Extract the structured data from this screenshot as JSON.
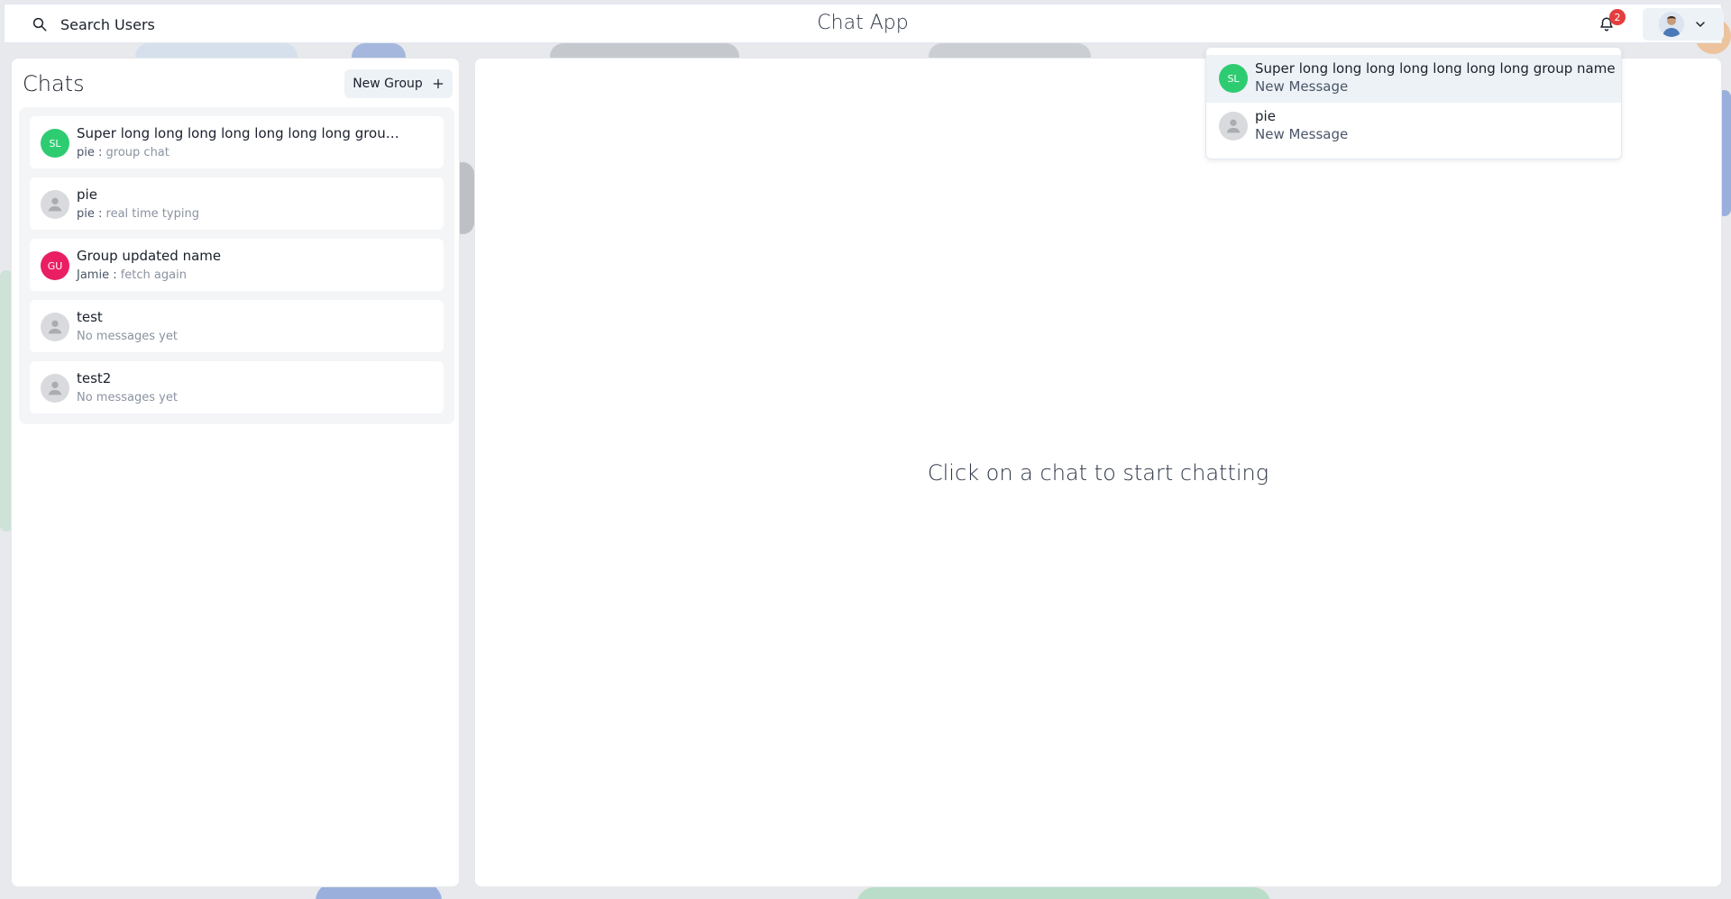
{
  "header": {
    "search_label": "Search Users",
    "app_title": "Chat App",
    "notification_count": "2"
  },
  "sidebar": {
    "title": "Chats",
    "new_group_label": "New Group",
    "chats": [
      {
        "name": "Super long long long long long long long group...",
        "initials": "SL",
        "avatar_color": "#2ecc71",
        "sender": "pie",
        "message": "group chat"
      },
      {
        "name": "pie",
        "initials": "",
        "avatar_color": "#d8dadd",
        "sender": "pie",
        "message": "real time typing"
      },
      {
        "name": "Group updated name",
        "initials": "GU",
        "avatar_color": "#e91e63",
        "sender": "Jamie",
        "message": "fetch again"
      },
      {
        "name": "test",
        "initials": "",
        "avatar_color": "#d8dadd",
        "sender": "",
        "message": "No messages yet"
      },
      {
        "name": "test2",
        "initials": "",
        "avatar_color": "#d8dadd",
        "sender": "",
        "message": "No messages yet"
      }
    ]
  },
  "main": {
    "empty_text": "Click on a chat to start chatting"
  },
  "notifications": [
    {
      "title": "Super long long long long long long long group name",
      "subtitle": "New Message",
      "initials": "SL",
      "avatar_color": "#2ecc71"
    },
    {
      "title": "pie",
      "subtitle": "New Message",
      "initials": "",
      "avatar_color": "#d8dadd"
    }
  ]
}
